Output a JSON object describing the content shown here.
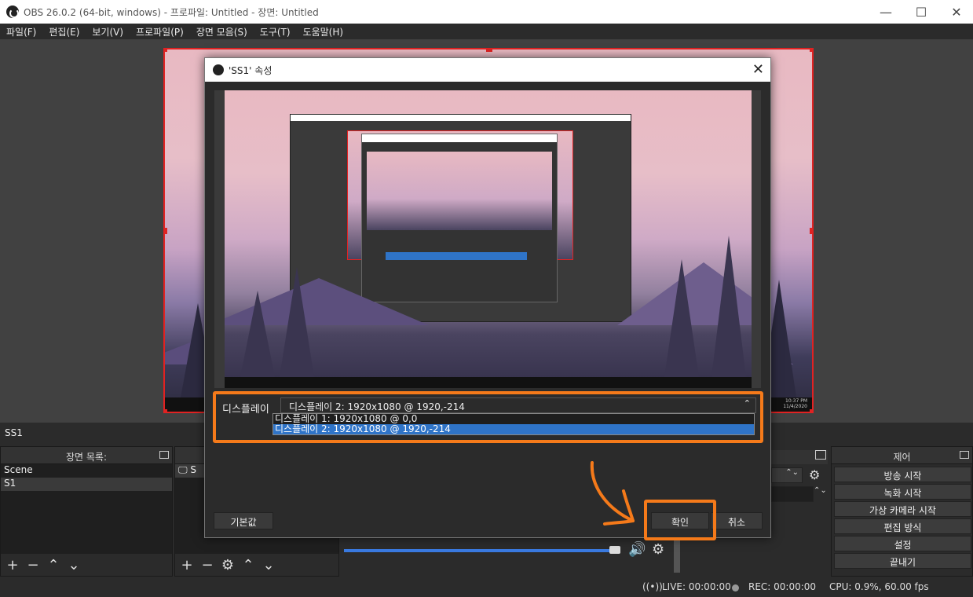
{
  "window": {
    "title": "OBS 26.0.2 (64-bit, windows) - 프로파일: Untitled - 장면: Untitled",
    "minimize": "—",
    "maximize": "☐",
    "close": "✕"
  },
  "menu": [
    "파일(F)",
    "편집(E)",
    "보기(V)",
    "프로파일(P)",
    "장면 모음(S)",
    "도구(T)",
    "도움말(H)"
  ],
  "scene_label": "SS1",
  "docks": {
    "scenes": {
      "title": "장면 목록:",
      "items": [
        "Scene",
        "S1"
      ]
    },
    "sources": {
      "items": [
        "S"
      ]
    },
    "controls": {
      "title": "제어",
      "buttons": [
        "방송 시작",
        "녹화 시작",
        "가상 카메라 시작",
        "편집 방식",
        "설정",
        "끝내기"
      ]
    }
  },
  "status": {
    "live": "LIVE: 00:00:00",
    "rec": "REC: 00:00:00",
    "cpu": "CPU: 0.9%, 60.00 fps"
  },
  "dialog": {
    "title": "'SS1' 속성",
    "close": "✕",
    "display_label": "디스플레이",
    "display_selected": "디스플레이 2: 1920x1080 @ 1920,-214",
    "display_options": [
      "디스플레이 1: 1920x1080 @ 0,0",
      "디스플레이 2: 1920x1080 @ 1920,-214"
    ],
    "defaults_button": "기본값",
    "ok_button": "확인",
    "cancel_button": "취소"
  },
  "taskbar": {
    "time": "10:37 PM",
    "date": "11/4/2020"
  },
  "colors": {
    "accent_red": "#e12222",
    "annotation_orange": "#f57a1a",
    "selection_blue": "#2f74c8"
  }
}
